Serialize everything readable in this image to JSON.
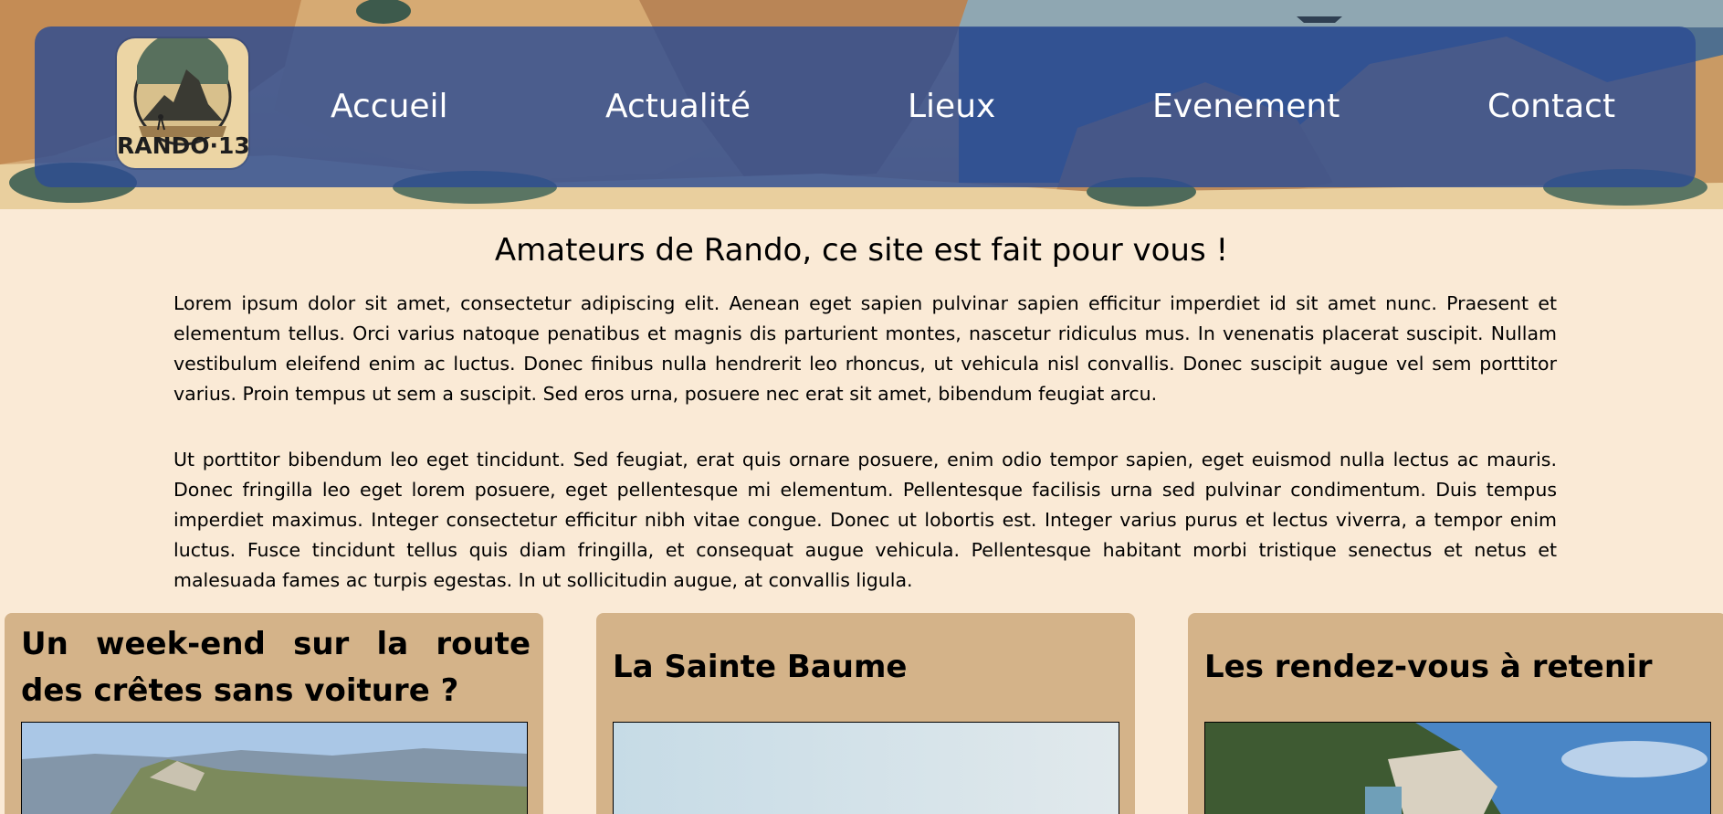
{
  "site": {
    "logo_text": "RANDO·13"
  },
  "nav": {
    "items": [
      {
        "label": "Accueil"
      },
      {
        "label": "Actualité"
      },
      {
        "label": "Lieux"
      },
      {
        "label": "Evenement"
      },
      {
        "label": "Contact"
      }
    ]
  },
  "main": {
    "title": "Amateurs de Rando, ce site est fait pour vous !",
    "paragraphs": [
      "Lorem ipsum dolor sit amet, consectetur adipiscing elit. Aenean eget sapien pulvinar sapien efficitur imperdiet id sit amet nunc. Praesent et elementum tellus. Orci varius natoque penatibus et magnis dis parturient montes, nascetur ridiculus mus. In venenatis placerat suscipit. Nullam vestibulum eleifend enim ac luctus. Donec finibus nulla hendrerit leo rhoncus, ut vehicula nisl convallis. Donec suscipit augue vel sem porttitor varius. Proin tempus ut sem a suscipit. Sed eros urna, posuere nec erat sit amet, bibendum feugiat arcu.",
      "Ut porttitor bibendum leo eget tincidunt. Sed feugiat, erat quis ornare posuere, enim odio tempor sapien, eget euismod nulla lectus ac mauris. Donec fringilla leo eget lorem posuere, eget pellentesque mi elementum. Pellentesque facilisis urna sed pulvinar condimentum. Duis tempus imperdiet maximus. Integer consectetur efficitur nibh vitae congue. Donec ut lobortis est. Integer varius purus et lectus viverra, a tempor enim luctus. Fusce tincidunt tellus quis diam fringilla, et consequat augue vehicula. Pellentesque habitant morbi tristique senectus et netus et malesuada fames ac turpis egestas. In ut sollicitudin augue, at convallis ligula."
    ]
  },
  "cards": [
    {
      "title": "Un week-end sur la route des crêtes sans voiture ?"
    },
    {
      "title": "La Sainte Baume"
    },
    {
      "title": "Les rendez-vous à retenir"
    }
  ],
  "colors": {
    "page_background": "#faead6",
    "navbar": "#2c4c92",
    "card_background": "#d4b389",
    "nav_text": "#ffffff"
  }
}
